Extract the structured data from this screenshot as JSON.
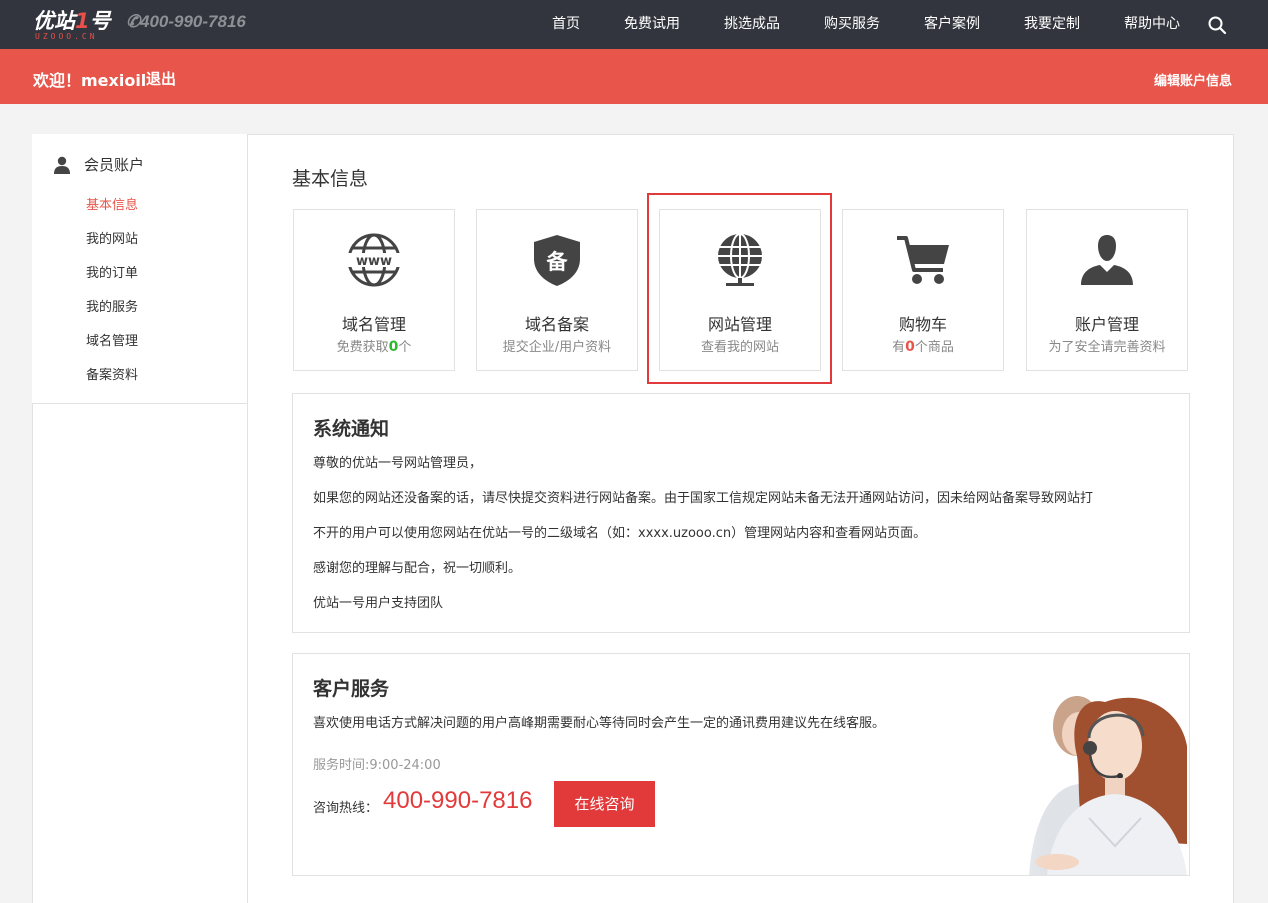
{
  "header": {
    "logo_text_a": "优站",
    "logo_text_b": "1",
    "logo_text_c": "号",
    "logo_sub": "UZOOO.CN",
    "phone": "400-990-7816",
    "nav": [
      "首页",
      "免费试用",
      "挑选成品",
      "购买服务",
      "客户案例",
      "我要定制",
      "帮助中心"
    ]
  },
  "welcome": {
    "greeting": "欢迎！mexioil",
    "logout": "退出",
    "edit_account": "编辑账户信息"
  },
  "sidebar": {
    "heading": "会员账户",
    "items": [
      "基本信息",
      "我的网站",
      "我的订单",
      "我的服务",
      "域名管理",
      "备案资料"
    ],
    "active_index": 0
  },
  "main": {
    "title": "基本信息",
    "cards": [
      {
        "icon": "www-globe-icon",
        "title": "域名管理",
        "sub_a": "免费获取",
        "count": "0",
        "sub_b": "个"
      },
      {
        "icon": "beian-shield-icon",
        "icon_text": "备",
        "title": "域名备案",
        "sub": "提交企业/用户资料"
      },
      {
        "icon": "website-globe-icon",
        "title": "网站管理",
        "sub": "查看我的网站"
      },
      {
        "icon": "shopping-cart-icon",
        "title": "购物车",
        "sub_a": "有",
        "count": "0",
        "sub_b": "个商品"
      },
      {
        "icon": "account-user-icon",
        "title": "账户管理",
        "sub": "为了安全请完善资料"
      }
    ]
  },
  "notice": {
    "title": "系统通知",
    "lines": [
      "尊敬的优站一号网站管理员，",
      "如果您的网站还没备案的话，请尽快提交资料进行网站备案。由于国家工信规定网站未备无法开通网站访问，因未给网站备案导致网站打",
      "不开的用户可以使用您网站在优站一号的二级域名（如：xxxx.uzooo.cn）管理网站内容和查看网站页面。",
      "感谢您的理解与配合，祝一切顺利。",
      "优站一号用户支持团队"
    ]
  },
  "service": {
    "title": "客户服务",
    "desc": "喜欢使用电话方式解决问题的用户高峰期需要耐心等待同时会产生一定的通讯费用建议先在线客服。",
    "hours": "服务时间:9:00-24:00",
    "hotline_label": "咨询热线：",
    "hotline": "400-990-7816",
    "consult_button": "在线咨询"
  },
  "colors": {
    "topbar": "#32353d",
    "accent": "#e8554a",
    "highlight": "#e23a3a",
    "green": "#2eb82e"
  }
}
